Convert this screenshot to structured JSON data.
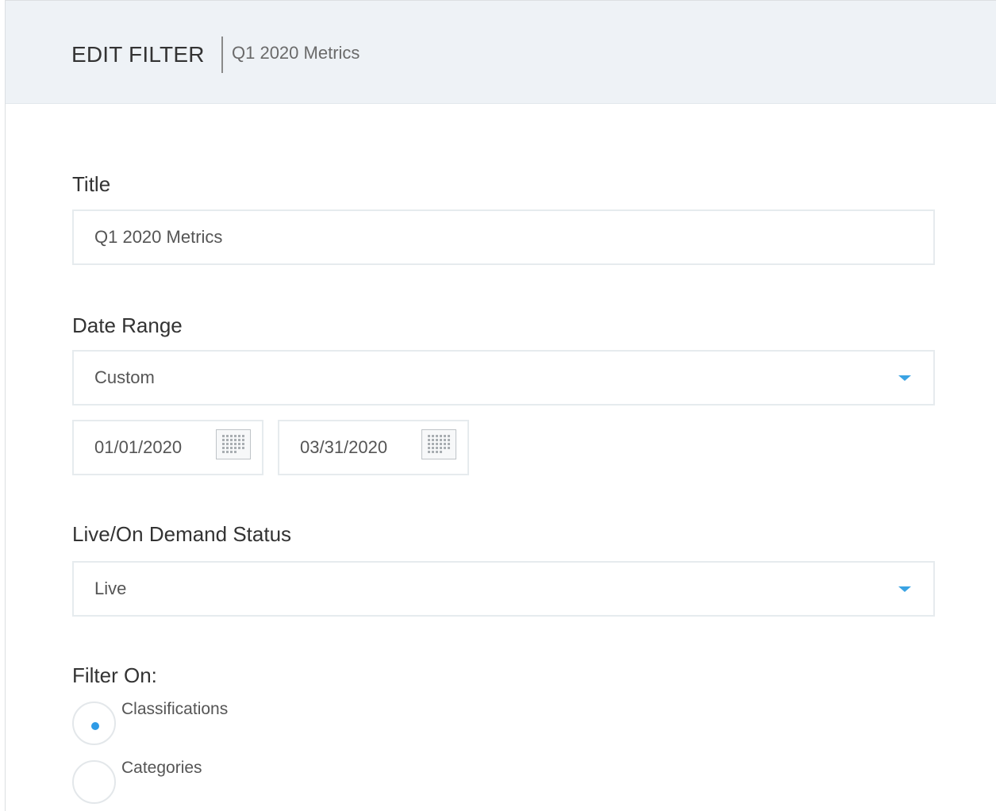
{
  "header": {
    "title": "EDIT FILTER",
    "subtitle": "Q1 2020 Metrics"
  },
  "form": {
    "title_label": "Title",
    "title_value": "Q1 2020 Metrics",
    "date_range_label": "Date Range",
    "date_range_value": "Custom",
    "start_date": "01/01/2020",
    "end_date": "03/31/2020",
    "status_label": "Live/On Demand Status",
    "status_value": "Live",
    "filter_on_label": "Filter On:",
    "filter_options": [
      {
        "label": "Classifications",
        "selected": true
      },
      {
        "label": "Categories",
        "selected": false
      }
    ]
  },
  "colors": {
    "accent": "#2e9be6",
    "header_bg": "#eef2f6",
    "field_border": "#e6ebee"
  },
  "icons": {
    "dropdown": "caret-down-icon",
    "calendar": "calendar-icon"
  }
}
